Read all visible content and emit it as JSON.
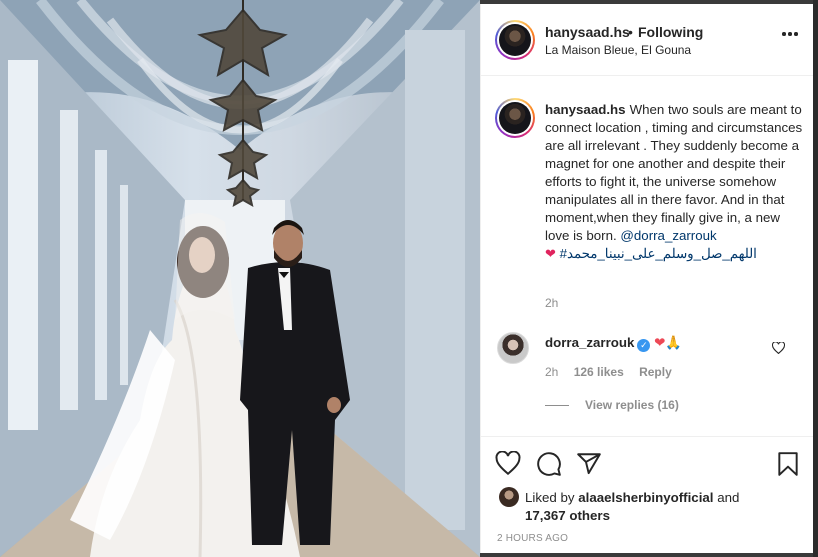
{
  "post": {
    "username": "hanysaad.hs",
    "dot": "•",
    "follow_status": "Following",
    "location": "La Maison Bleue, El Gouna"
  },
  "caption": {
    "username": "hanysaad.hs",
    "text": "When two souls are meant to connect location , timing and circumstances are all irrelevant . They suddenly become a magnet for one another and despite their efforts to fight it, the universe somehow manipulates all in there favor. And in that moment,when they finally give in, a new love is born.",
    "mention": "@dorra_zarrouk",
    "heart": "❤",
    "hashtag": "#اللهم_صل_وسلم_على_نبينا_محمد",
    "time": "2h"
  },
  "comment": {
    "username": "dorra_zarrouk",
    "verified": "✓",
    "text_heart": "❤",
    "text_pray": "🙏",
    "time": "2h",
    "likes": "126 likes",
    "reply": "Reply",
    "view_replies": "View replies (16)"
  },
  "likes": {
    "prefix": "Liked by",
    "user": "alaaelsherbinyofficial",
    "and": "and",
    "others": "17,367 others"
  },
  "post_time": "2 HOURS AGO",
  "icons": {
    "more": "more-options-icon",
    "like": "heart-icon",
    "comment": "comment-icon",
    "share": "share-icon",
    "save": "bookmark-icon"
  },
  "colors": {
    "link": "#00376b",
    "verified": "#3897f0",
    "heart": "#ed4956",
    "muted": "#8e8e8e"
  }
}
